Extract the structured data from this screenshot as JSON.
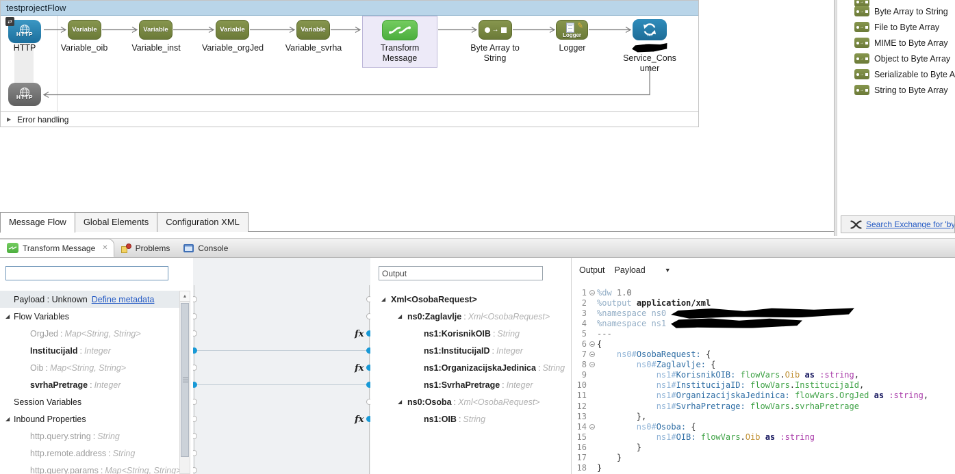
{
  "flow": {
    "title": "testprojectFlow",
    "error_handling": "Error handling",
    "http_source": {
      "icon_text": "HTTP",
      "label": "HTTP"
    },
    "http_response": {
      "icon_text": "HTTP"
    },
    "variables": [
      {
        "badge": "Variable",
        "label": "Variable_oib"
      },
      {
        "badge": "Variable",
        "label": "Variable_inst"
      },
      {
        "badge": "Variable",
        "label": "Variable_orgJed"
      },
      {
        "badge": "Variable",
        "label": "Variable_svrha"
      }
    ],
    "transform": {
      "label": "Transform Message"
    },
    "byte_array_to_string": {
      "label": "Byte Array to String"
    },
    "logger": {
      "badge": "Logger",
      "label": "Logger"
    },
    "service_consumer": {
      "badge": "ws",
      "label_line1": "Service_Cons",
      "label_line2": "umer",
      "label_redacted": true
    }
  },
  "palette": {
    "items": [
      "Byte Array to String",
      "File to Byte Array",
      "MIME to Byte Array",
      "Object to Byte Array",
      "Serializable to Byte Array",
      "String to Byte Array"
    ],
    "search_link": "Search Exchange for 'byt"
  },
  "flow_editor_tabs": [
    {
      "label": "Message Flow",
      "active": true
    },
    {
      "label": "Global Elements",
      "active": false
    },
    {
      "label": "Configuration XML",
      "active": false
    }
  ],
  "view_tabs": {
    "transform": "Transform Message",
    "problems": "Problems",
    "console": "Console"
  },
  "transform": {
    "input_tree": {
      "search_value": "",
      "payload_label": "Payload : Unknown",
      "define_metadata_link": "Define metadata",
      "rows": [
        {
          "kind": "group",
          "label": "Flow Variables",
          "twistie": true
        },
        {
          "kind": "field",
          "name": "OrgJed",
          "type": "Map<String, String>",
          "muted": true
        },
        {
          "kind": "field",
          "name": "InstitucijaId",
          "type": "Integer",
          "muted": false
        },
        {
          "kind": "field",
          "name": "Oib",
          "type": "Map<String, String>",
          "muted": true
        },
        {
          "kind": "field",
          "name": "svrhaPretrage",
          "type": "Integer",
          "muted": false
        },
        {
          "kind": "group",
          "label": "Session Variables",
          "twistie": false
        },
        {
          "kind": "group",
          "label": "Inbound Properties",
          "twistie": true
        },
        {
          "kind": "field",
          "name": "http.query.string",
          "type": "String",
          "muted": true
        },
        {
          "kind": "field",
          "name": "http.remote.address",
          "type": "String",
          "muted": true
        },
        {
          "kind": "field",
          "name": "http.query.params",
          "type": "Map<String, String>",
          "muted": true
        }
      ]
    },
    "output_tree": {
      "filter_value": "Output",
      "rows": [
        {
          "name": "Xml<OsobaRequest>",
          "type": "",
          "level": 0,
          "twistie": true
        },
        {
          "name": "ns0:Zaglavlje",
          "type": "Xml<OsobaRequest>",
          "level": 1,
          "twistie": true
        },
        {
          "name": "ns1:KorisnikOIB",
          "type": "String",
          "level": 2,
          "twistie": false
        },
        {
          "name": "ns1:InstitucijaID",
          "type": "Integer",
          "level": 2,
          "twistie": false
        },
        {
          "name": "ns1:OrganizacijskaJedinica",
          "type": "String",
          "level": 2,
          "twistie": false
        },
        {
          "name": "ns1:SvrhaPretrage",
          "type": "Integer",
          "level": 2,
          "twistie": false
        },
        {
          "name": "ns0:Osoba",
          "type": "Xml<OsobaRequest>",
          "level": 1,
          "twistie": true
        },
        {
          "name": "ns1:OIB",
          "type": "String",
          "level": 2,
          "twistie": false
        }
      ]
    },
    "mapping": {
      "connections": [
        {
          "source": "InstitucijaId",
          "target": "ns1:InstitucijaID"
        },
        {
          "source": "svrhaPretrage",
          "target": "ns1:SvrhaPretrage"
        }
      ],
      "expression_targets": [
        "ns1:KorisnikOIB",
        "ns1:OrganizacijskaJedinica",
        "ns1:OIB"
      ]
    },
    "code": {
      "header": {
        "left": "Output",
        "right": "Payload"
      },
      "lines": [
        {
          "n": 1,
          "fold": true,
          "tokens": [
            [
              "dir",
              "%dw"
            ],
            [
              "plain",
              " "
            ],
            [
              "ver",
              "1.0"
            ]
          ]
        },
        {
          "n": 2,
          "fold": false,
          "tokens": [
            [
              "dir",
              "%output"
            ],
            [
              "plain",
              " "
            ],
            [
              "mime",
              "application/xml"
            ]
          ]
        },
        {
          "n": 3,
          "fold": false,
          "tokens": [
            [
              "dir",
              "%namespace"
            ],
            [
              "plain",
              " "
            ],
            [
              "dir",
              "ns0"
            ],
            [
              "plain",
              " "
            ],
            [
              "redact",
              "wide"
            ]
          ]
        },
        {
          "n": 4,
          "fold": false,
          "tokens": [
            [
              "dir",
              "%namespace"
            ],
            [
              "plain",
              " "
            ],
            [
              "dir",
              "ns1"
            ],
            [
              "plain",
              " "
            ],
            [
              "redact",
              "med"
            ]
          ]
        },
        {
          "n": 5,
          "fold": false,
          "tokens": [
            [
              "sep",
              "---"
            ]
          ]
        },
        {
          "n": 6,
          "fold": true,
          "tokens": [
            [
              "plain",
              "{"
            ]
          ]
        },
        {
          "n": 7,
          "fold": true,
          "tokens": [
            [
              "plain",
              "    "
            ],
            [
              "pre",
              "ns0#"
            ],
            [
              "el",
              "OsobaRequest:"
            ],
            [
              "plain",
              " {"
            ]
          ]
        },
        {
          "n": 8,
          "fold": true,
          "tokens": [
            [
              "plain",
              "        "
            ],
            [
              "pre",
              "ns0#"
            ],
            [
              "el",
              "Zaglavlje:"
            ],
            [
              "plain",
              " {"
            ]
          ]
        },
        {
          "n": 9,
          "fold": false,
          "tokens": [
            [
              "plain",
              "            "
            ],
            [
              "pre",
              "ns1#"
            ],
            [
              "el",
              "KorisnikOIB:"
            ],
            [
              "plain",
              " "
            ],
            [
              "var",
              "flowVars"
            ],
            [
              "plain",
              "."
            ],
            [
              "prop",
              "Oib"
            ],
            [
              "plain",
              " "
            ],
            [
              "kw",
              "as"
            ],
            [
              "plain",
              " "
            ],
            [
              "type",
              ":string"
            ],
            [
              "plain",
              ","
            ]
          ]
        },
        {
          "n": 10,
          "fold": false,
          "tokens": [
            [
              "plain",
              "            "
            ],
            [
              "pre",
              "ns1#"
            ],
            [
              "el",
              "InstitucijaID:"
            ],
            [
              "plain",
              " "
            ],
            [
              "var",
              "flowVars"
            ],
            [
              "plain",
              "."
            ],
            [
              "var",
              "InstitucijaId"
            ],
            [
              "plain",
              ","
            ]
          ]
        },
        {
          "n": 11,
          "fold": false,
          "tokens": [
            [
              "plain",
              "            "
            ],
            [
              "pre",
              "ns1#"
            ],
            [
              "el",
              "OrganizacijskaJedinica:"
            ],
            [
              "plain",
              " "
            ],
            [
              "var",
              "flowVars"
            ],
            [
              "plain",
              "."
            ],
            [
              "var",
              "OrgJed"
            ],
            [
              "plain",
              " "
            ],
            [
              "kw",
              "as"
            ],
            [
              "plain",
              " "
            ],
            [
              "type",
              ":string"
            ],
            [
              "plain",
              ","
            ]
          ]
        },
        {
          "n": 12,
          "fold": false,
          "tokens": [
            [
              "plain",
              "            "
            ],
            [
              "pre",
              "ns1#"
            ],
            [
              "el",
              "SvrhaPretrage:"
            ],
            [
              "plain",
              " "
            ],
            [
              "var",
              "flowVars"
            ],
            [
              "plain",
              "."
            ],
            [
              "var",
              "svrhaPretrage"
            ]
          ]
        },
        {
          "n": 13,
          "fold": false,
          "tokens": [
            [
              "plain",
              "        },"
            ]
          ]
        },
        {
          "n": 14,
          "fold": true,
          "tokens": [
            [
              "plain",
              "        "
            ],
            [
              "pre",
              "ns0#"
            ],
            [
              "el",
              "Osoba:"
            ],
            [
              "plain",
              " {"
            ]
          ]
        },
        {
          "n": 15,
          "fold": false,
          "tokens": [
            [
              "plain",
              "            "
            ],
            [
              "pre",
              "ns1#"
            ],
            [
              "el",
              "OIB:"
            ],
            [
              "plain",
              " "
            ],
            [
              "var",
              "flowVars"
            ],
            [
              "plain",
              "."
            ],
            [
              "prop",
              "Oib"
            ],
            [
              "plain",
              " "
            ],
            [
              "kw",
              "as"
            ],
            [
              "plain",
              " "
            ],
            [
              "type",
              ":string"
            ]
          ]
        },
        {
          "n": 16,
          "fold": false,
          "tokens": [
            [
              "plain",
              "        }"
            ]
          ]
        },
        {
          "n": 17,
          "fold": false,
          "tokens": [
            [
              "plain",
              "    }"
            ]
          ]
        },
        {
          "n": 18,
          "fold": false,
          "tokens": [
            [
              "plain",
              "}"
            ]
          ]
        }
      ]
    }
  },
  "colors": {
    "flow_title_bar": "#b9d5e9",
    "variable_node": "#6b7a38",
    "transform_node": "#4cae3e",
    "http_node": "#1c6f9d",
    "mapping_dot": "#1899d6",
    "link_blue": "#2359c4"
  }
}
